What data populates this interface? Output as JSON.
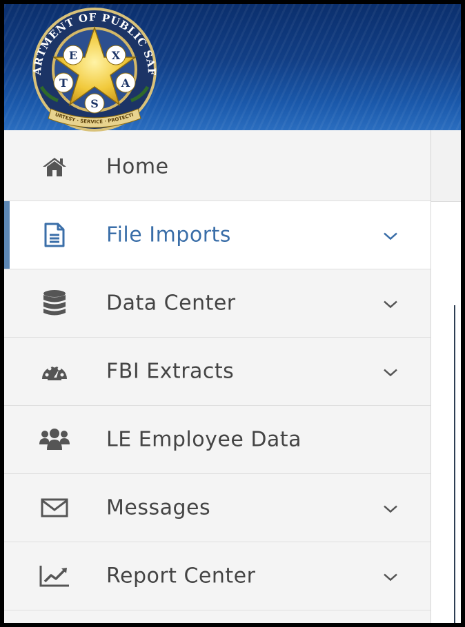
{
  "logo": {
    "ring_top_text": "DEPARTMENT OF PUBLIC SAFETY",
    "letters": [
      "T",
      "E",
      "X",
      "A",
      "S"
    ],
    "ribbon_text": "COURTESY · SERVICE · PROTECTION"
  },
  "colors": {
    "header_blue": "#123f86",
    "active_accent": "#5c87b5",
    "active_text": "#3a6ea8",
    "icon_gray": "#555555"
  },
  "sidebar": {
    "items": [
      {
        "label": "Home",
        "icon": "home-icon",
        "has_submenu": false,
        "active": false
      },
      {
        "label": "File Imports",
        "icon": "file-icon",
        "has_submenu": true,
        "active": true
      },
      {
        "label": "Data Center",
        "icon": "database-icon",
        "has_submenu": true,
        "active": false
      },
      {
        "label": "FBI Extracts",
        "icon": "dashboard-gauge-icon",
        "has_submenu": true,
        "active": false
      },
      {
        "label": "LE Employee Data",
        "icon": "users-icon",
        "has_submenu": false,
        "active": false
      },
      {
        "label": "Messages",
        "icon": "envelope-icon",
        "has_submenu": true,
        "active": false
      },
      {
        "label": "Report Center",
        "icon": "line-chart-icon",
        "has_submenu": true,
        "active": false
      }
    ]
  }
}
